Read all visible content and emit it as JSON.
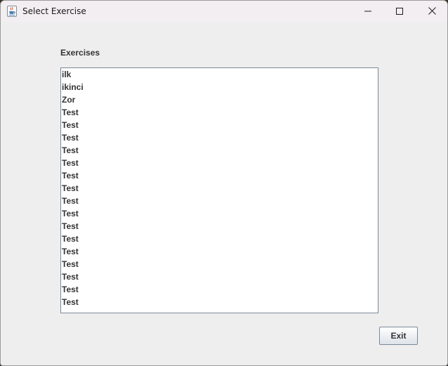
{
  "window": {
    "title": "Select Exercise",
    "app_icon": "java-cup-icon",
    "controls": {
      "minimize_icon": "minimize-icon",
      "maximize_icon": "maximize-icon",
      "close_icon": "close-icon"
    }
  },
  "exercises": {
    "label": "Exercises",
    "items": [
      "ilk",
      "ikinci",
      "Zor",
      "Test",
      "Test",
      "Test",
      "Test",
      "Test",
      "Test",
      "Test",
      "Test",
      "Test",
      "Test",
      "Test",
      "Test",
      "Test",
      "Test",
      "Test",
      "Test"
    ]
  },
  "actions": {
    "exit_label": "Exit"
  }
}
